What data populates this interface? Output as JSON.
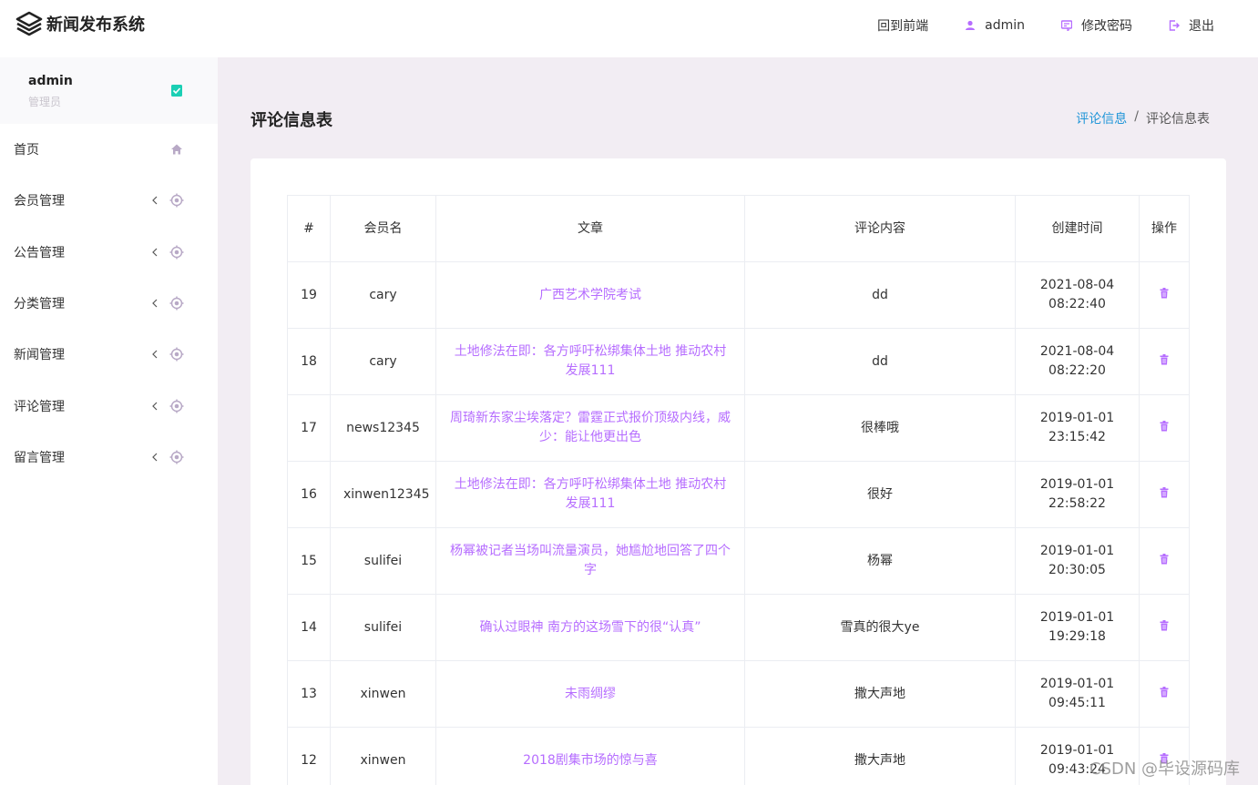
{
  "brand": {
    "title": "新闻发布系统"
  },
  "topnav": {
    "frontend": "回到前端",
    "user": "admin",
    "password": "修改密码",
    "logout": "退出"
  },
  "sidebar": {
    "profile": {
      "name": "admin",
      "role": "管理员"
    },
    "items": [
      {
        "label": "首页"
      },
      {
        "label": "会员管理"
      },
      {
        "label": "公告管理"
      },
      {
        "label": "分类管理"
      },
      {
        "label": "新闻管理"
      },
      {
        "label": "评论管理"
      },
      {
        "label": "留言管理"
      }
    ]
  },
  "page": {
    "title": "评论信息表",
    "breadcrumb": {
      "parent": "评论信息",
      "separator": "/",
      "current": "评论信息表"
    }
  },
  "table": {
    "headers": [
      "#",
      "会员名",
      "文章",
      "评论内容",
      "创建时间",
      "操作"
    ],
    "rows": [
      {
        "id": "19",
        "member": "cary",
        "article": "广西艺术学院考试",
        "content": "dd",
        "date": "2021-08-04",
        "time": "08:22:40"
      },
      {
        "id": "18",
        "member": "cary",
        "article": "土地修法在即：各方呼吁松绑集体土地 推动农村发展111",
        "content": "dd",
        "date": "2021-08-04",
        "time": "08:22:20"
      },
      {
        "id": "17",
        "member": "news12345",
        "article": "周琦新东家尘埃落定？雷霆正式报价顶级内线，威少：能让他更出色",
        "content": "很棒哦",
        "date": "2019-01-01",
        "time": "23:15:42"
      },
      {
        "id": "16",
        "member": "xinwen12345",
        "article": "土地修法在即：各方呼吁松绑集体土地 推动农村发展111",
        "content": "很好",
        "date": "2019-01-01",
        "time": "22:58:22"
      },
      {
        "id": "15",
        "member": "sulifei",
        "article": "杨幂被记者当场叫流量演员，她尴尬地回答了四个字",
        "content": "杨幂",
        "date": "2019-01-01",
        "time": "20:30:05"
      },
      {
        "id": "14",
        "member": "sulifei",
        "article": "确认过眼神 南方的这场雪下的很“认真”",
        "content": "雪真的很大ye",
        "date": "2019-01-01",
        "time": "19:29:18"
      },
      {
        "id": "13",
        "member": "xinwen",
        "article": "未雨绸缪",
        "content": "撒大声地",
        "date": "2019-01-01",
        "time": "09:45:11"
      },
      {
        "id": "12",
        "member": "xinwen",
        "article": "2018剧集市场的惊与喜",
        "content": "撒大声地",
        "date": "2019-01-01",
        "time": "09:43:24"
      }
    ]
  },
  "watermark": "CSDN @毕设源码库",
  "colors": {
    "accent": "#b66dff",
    "link_blue": "#2196d8",
    "bg": "#f2edf3"
  },
  "icons": {
    "brand": "layers-icon",
    "user": "user-icon",
    "password": "key-icon",
    "logout": "logout-icon",
    "home": "home-icon",
    "expand": "chevron-left-icon",
    "crosshair": "crosshair-icon",
    "delete": "trash-icon"
  }
}
